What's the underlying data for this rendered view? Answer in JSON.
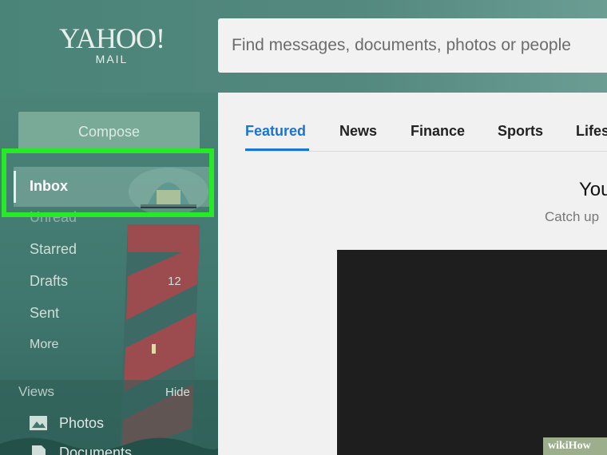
{
  "header": {
    "logo_main": "YAHOO!",
    "logo_sub": "MAIL",
    "search_placeholder": "Find messages, documents, photos or people"
  },
  "sidebar": {
    "compose_label": "Compose",
    "items": [
      {
        "label": "Inbox",
        "selected": true
      },
      {
        "label": "Unread"
      },
      {
        "label": "Starred"
      },
      {
        "label": "Drafts",
        "count": "12"
      },
      {
        "label": "Sent"
      },
      {
        "label": "More"
      }
    ],
    "views": {
      "title": "Views",
      "hide_label": "Hide",
      "items": [
        {
          "label": "Photos",
          "icon": "photo-icon"
        },
        {
          "label": "Documents",
          "icon": "document-icon"
        }
      ]
    }
  },
  "main": {
    "tabs": [
      {
        "label": "Featured",
        "active": true
      },
      {
        "label": "News"
      },
      {
        "label": "Finance"
      },
      {
        "label": "Sports"
      },
      {
        "label": "Lifes"
      }
    ],
    "hero_title": "You",
    "hero_subtitle": "Catch up"
  },
  "colors": {
    "accent": "#1a74d2",
    "highlight": "#26ea26",
    "sidebar": "#3f766d"
  },
  "watermark": "wikiHow"
}
